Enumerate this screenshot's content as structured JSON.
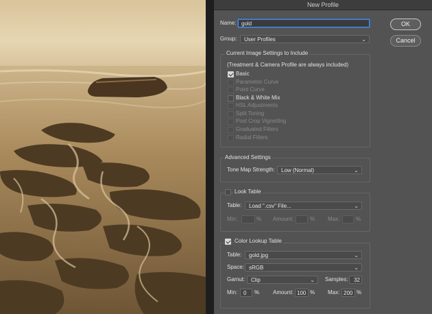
{
  "dialog": {
    "title": "New Profile"
  },
  "name_label": "Name:",
  "name_value": "gold",
  "group_label": "Group:",
  "group_value": "User Profiles",
  "ok_label": "OK",
  "cancel_label": "Cancel",
  "current": {
    "title": "Current Image Settings to Include",
    "note": "(Treatment & Camera Profile are always included)",
    "items": [
      {
        "label": "Basic",
        "checked": true,
        "enabled": true
      },
      {
        "label": "Parametric Curve",
        "checked": false,
        "enabled": false
      },
      {
        "label": "Point Curve",
        "checked": false,
        "enabled": false
      },
      {
        "label": "Black & White Mix",
        "checked": false,
        "enabled": true
      },
      {
        "label": "HSL Adjustments",
        "checked": false,
        "enabled": false
      },
      {
        "label": "Split Toning",
        "checked": false,
        "enabled": false
      },
      {
        "label": "Post Crop Vignetting",
        "checked": false,
        "enabled": false
      },
      {
        "label": "Graduated Filters",
        "checked": false,
        "enabled": false
      },
      {
        "label": "Radial Filters",
        "checked": false,
        "enabled": false
      }
    ]
  },
  "advanced": {
    "title": "Advanced Settings",
    "tone_label": "Tone Map Strength:",
    "tone_value": "Low (Normal)"
  },
  "look": {
    "title": "Look Table",
    "checked": false,
    "table_label": "Table:",
    "table_value": "Load \".csv\" File...",
    "min_label": "Min:",
    "amount_label": "Amount:",
    "max_label": "Max:",
    "pct": "%"
  },
  "clut": {
    "title": "Color Lookup Table",
    "checked": true,
    "table_label": "Table:",
    "table_value": "gold.jpg",
    "space_label": "Space:",
    "space_value": "sRGB",
    "gamut_label": "Gamut:",
    "gamut_value": "Clip",
    "samples_label": "Samples:",
    "samples_value": "32",
    "min_label": "Min:",
    "min_value": "0",
    "amount_label": "Amount:",
    "amount_value": "100",
    "max_label": "Max:",
    "max_value": "200",
    "pct": "%"
  }
}
